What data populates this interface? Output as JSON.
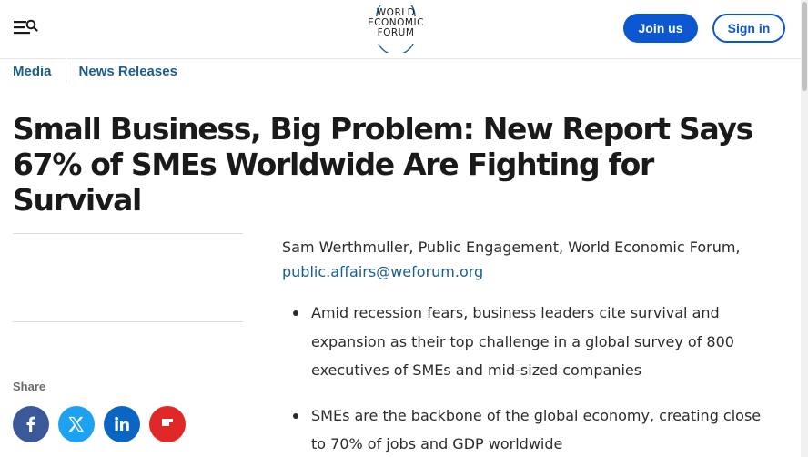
{
  "header": {
    "logo_lines": [
      "WORLD",
      "ECONOMIC",
      "FORUM"
    ],
    "join_label": "Join us",
    "signin_label": "Sign in",
    "menu_icon": "menu-search-icon"
  },
  "breadcrumb": [
    "Media",
    "News Releases"
  ],
  "article": {
    "title_lines": [
      "Small Business, Big Problem: New Report Says",
      "67% of SMEs Worldwide Are Fighting for",
      "Survival"
    ],
    "contact_text": "Sam Werthmuller, Public Engagement, World Economic Forum,",
    "contact_email": "public.affairs@weforum.org",
    "bullets": [
      [
        "Amid recession fears, business leaders cite survival and",
        "expansion as their top challenge in a global survey of 800",
        "executives of SMEs and mid-sized companies"
      ],
      [
        "SMEs are the backbone of the global economy, creating close",
        "to 70% of jobs and GDP worldwide"
      ]
    ]
  },
  "share": {
    "label": "Share",
    "buttons": [
      {
        "icon": "facebook-icon",
        "color": "#3b5998"
      },
      {
        "icon": "x-icon",
        "color": "#1da1f2"
      },
      {
        "icon": "linkedin-icon",
        "color": "#0a66c2"
      },
      {
        "icon": "flipboard-icon",
        "color": "#e12828"
      }
    ]
  },
  "colors": {
    "accent": "#0b57d0",
    "link": "#1b5e8c"
  }
}
